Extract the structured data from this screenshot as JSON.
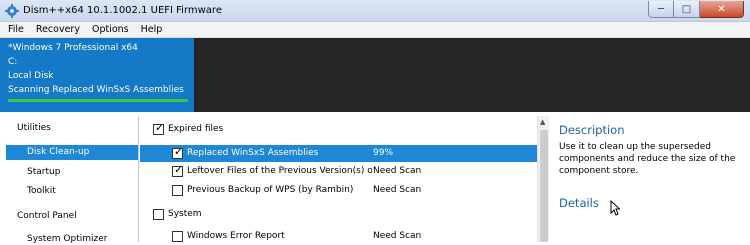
{
  "window": {
    "title": "Dism++x64 10.1.1002.1 UEFI Firmware",
    "controls": {
      "minimize": "─",
      "maximize": "□",
      "close": "✕"
    }
  },
  "menu": [
    "File",
    "Recovery",
    "Options",
    "Help"
  ],
  "header": {
    "lines": [
      "*Windows 7 Professional x64",
      "C:",
      "Local Disk",
      "Scanning Replaced WinSxS Assemblies"
    ],
    "progress": 1.0,
    "colors": {
      "info_bg": "#1479c6",
      "bar_bg": "#252525",
      "progress": "#3cc63c"
    }
  },
  "sidebar": {
    "items": [
      {
        "label": "Utilities",
        "type": "group",
        "selected": false
      },
      {
        "label": "Disk Clean-up",
        "type": "sub",
        "selected": true
      },
      {
        "label": "Startup",
        "type": "sub",
        "selected": false
      },
      {
        "label": "Toolkit",
        "type": "sub",
        "selected": false
      },
      {
        "label": "Control Panel",
        "type": "group",
        "selected": false
      },
      {
        "label": "System Optimizer",
        "type": "sub",
        "selected": false
      }
    ]
  },
  "cleanup_list": {
    "rows": [
      {
        "label": "Expired files",
        "status": "",
        "checked": true,
        "level": 0,
        "selected": false
      },
      {
        "label": "Replaced WinSxS Assemblies",
        "status": "99%",
        "checked": true,
        "level": 1,
        "selected": true
      },
      {
        "label": "Leftover Files of the Previous Version(s) of Dism",
        "status": "Need Scan",
        "checked": true,
        "level": 1,
        "selected": false
      },
      {
        "label": "Previous Backup of WPS (by Rambin)",
        "status": "Need Scan",
        "checked": false,
        "level": 1,
        "selected": false
      },
      {
        "label": "System",
        "status": "",
        "checked": false,
        "level": 0,
        "selected": false
      },
      {
        "label": "Windows Error Report",
        "status": "Need Scan",
        "checked": false,
        "level": 1,
        "selected": false
      }
    ]
  },
  "details_panel": {
    "description_title": "Description",
    "description_text": "Use it to clean up the superseded components and reduce the size of the component store.",
    "details_title": "Details"
  },
  "colors": {
    "accent": "#1e88d6",
    "heading": "#1f5fa8"
  }
}
